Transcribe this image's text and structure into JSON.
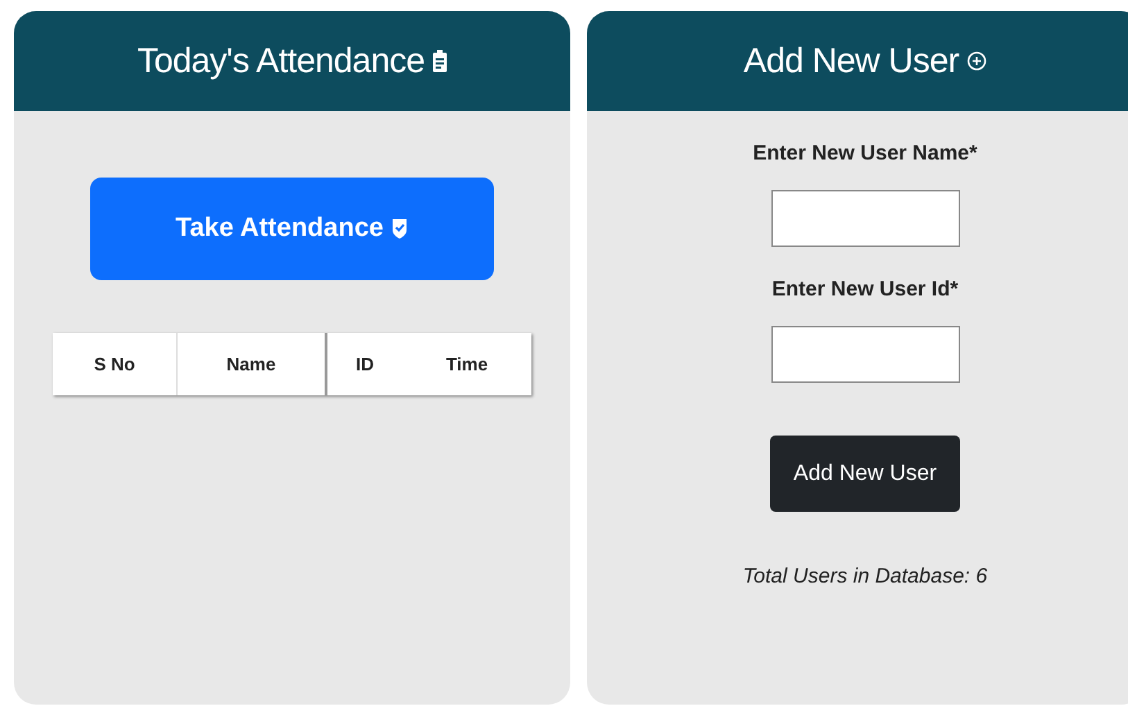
{
  "attendance_panel": {
    "title": "Today's Attendance",
    "take_button": "Take Attendance",
    "table": {
      "columns": [
        "S No",
        "Name",
        "ID",
        "Time"
      ]
    }
  },
  "add_user_panel": {
    "title": "Add New User",
    "fields": [
      {
        "label": "Enter New User Name*"
      },
      {
        "label": "Enter New User Id*"
      }
    ],
    "submit_button": "Add New User",
    "total_users": "Total Users in Database: 6"
  }
}
